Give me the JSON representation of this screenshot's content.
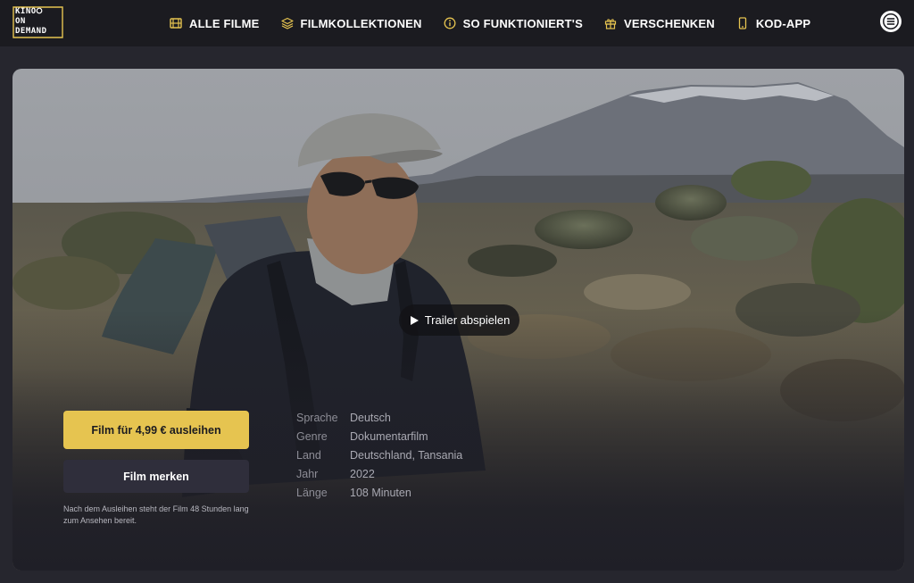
{
  "brand": {
    "logo_lines": [
      "KINO",
      "ON",
      "DEMAND"
    ],
    "accent_color": "#e6c450"
  },
  "nav": {
    "items": [
      {
        "label": "ALLE FILME",
        "icon": "film-icon"
      },
      {
        "label": "FILMKOLLEKTIONEN",
        "icon": "layers-icon"
      },
      {
        "label": "SO FUNKTIONIERT'S",
        "icon": "info-icon"
      },
      {
        "label": "VERSCHENKEN",
        "icon": "gift-icon"
      },
      {
        "label": "KOD-APP",
        "icon": "phone-icon"
      }
    ],
    "menu_icon": "menu-icon"
  },
  "hero": {
    "trailer_label": "Trailer abspielen",
    "rent_label": "Film für 4,99 € ausleihen",
    "watchlist_label": "Film merken",
    "rent_note": "Nach dem Ausleihen steht der Film 48 Stunden lang zum Ansehen bereit.",
    "meta": [
      {
        "key": "Sprache",
        "value": "Deutsch"
      },
      {
        "key": "Genre",
        "value": "Dokumentarfilm"
      },
      {
        "key": "Land",
        "value": "Deutschland, Tansania"
      },
      {
        "key": "Jahr",
        "value": "2022"
      },
      {
        "key": "Länge",
        "value": "108 Minuten"
      }
    ]
  }
}
